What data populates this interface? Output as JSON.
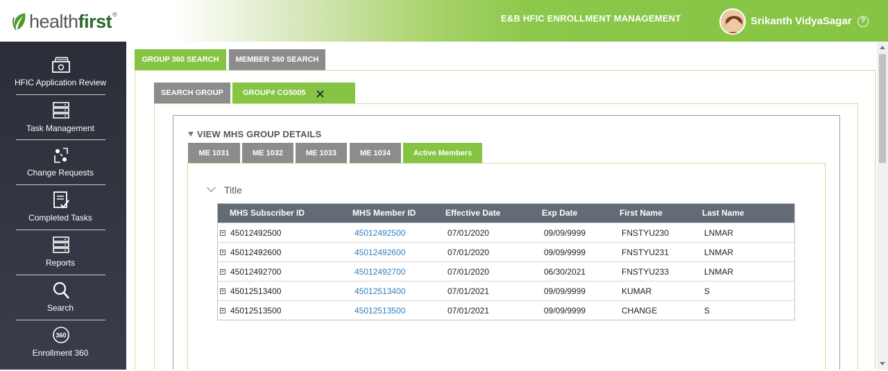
{
  "header": {
    "logo_text_a": "health",
    "logo_text_b": "first",
    "logo_reg": "®",
    "app_title": "E&B HFIC ENROLLMENT MANAGEMENT",
    "user_name": "Srikanth VidyaSagar",
    "help_label": "?"
  },
  "sidebar": {
    "items": [
      {
        "label": "HFIC Application Review",
        "icon": "application-review-icon"
      },
      {
        "label": "Task Management",
        "icon": "task-management-icon"
      },
      {
        "label": "Change Requests",
        "icon": "change-requests-icon"
      },
      {
        "label": "Completed Tasks",
        "icon": "completed-tasks-icon"
      },
      {
        "label": "Reports",
        "icon": "reports-icon"
      },
      {
        "label": "Search",
        "icon": "search-icon"
      },
      {
        "label": "Enrollment 360",
        "icon": "enrollment-360-icon",
        "icon_text": "360"
      }
    ]
  },
  "top_tabs": [
    {
      "label": "GROUP 360 SEARCH",
      "active": true
    },
    {
      "label": "MEMBER 360 SEARCH",
      "active": false
    }
  ],
  "sub_tabs": [
    {
      "label": "SEARCH GROUP",
      "active": false
    },
    {
      "label": "GROUP# CG5005",
      "active": true,
      "closable": true
    }
  ],
  "section_title": "VIEW MHS GROUP DETAILS",
  "me_tabs": [
    {
      "label": "ME 1031",
      "active": false
    },
    {
      "label": "ME 1032",
      "active": false
    },
    {
      "label": "ME 1033",
      "active": false
    },
    {
      "label": "ME 1034",
      "active": false
    },
    {
      "label": "Active Members",
      "active": true
    }
  ],
  "panel_title": "Title",
  "table": {
    "columns": [
      "MHS Subscriber ID",
      "MHS Member ID",
      "Effective Date",
      "Exp Date",
      "First Name",
      "Last Name"
    ],
    "rows": [
      [
        "45012492500",
        "45012492500",
        "07/01/2020",
        "09/09/9999",
        "FNSTYU230",
        "LNMAR"
      ],
      [
        "45012492600",
        "45012492600",
        "07/01/2020",
        "09/09/9999",
        "FNSTYU231",
        "LNMAR"
      ],
      [
        "45012492700",
        "45012492700",
        "07/01/2020",
        "06/30/2021",
        "FNSTYU233",
        "LNMAR"
      ],
      [
        "45012513400",
        "45012513400",
        "07/01/2021",
        "09/09/9999",
        "KUMAR",
        "S"
      ],
      [
        "45012513500",
        "45012513500",
        "07/01/2021",
        "09/09/9999",
        "CHANGE",
        "S"
      ]
    ],
    "expand_symbol": "+"
  },
  "colors": {
    "brand_green": "#86c443",
    "sidebar_bg": "#2b2d38",
    "tab_gray": "#8c8c8c",
    "table_header": "#636b76",
    "link": "#2f7fbf"
  }
}
